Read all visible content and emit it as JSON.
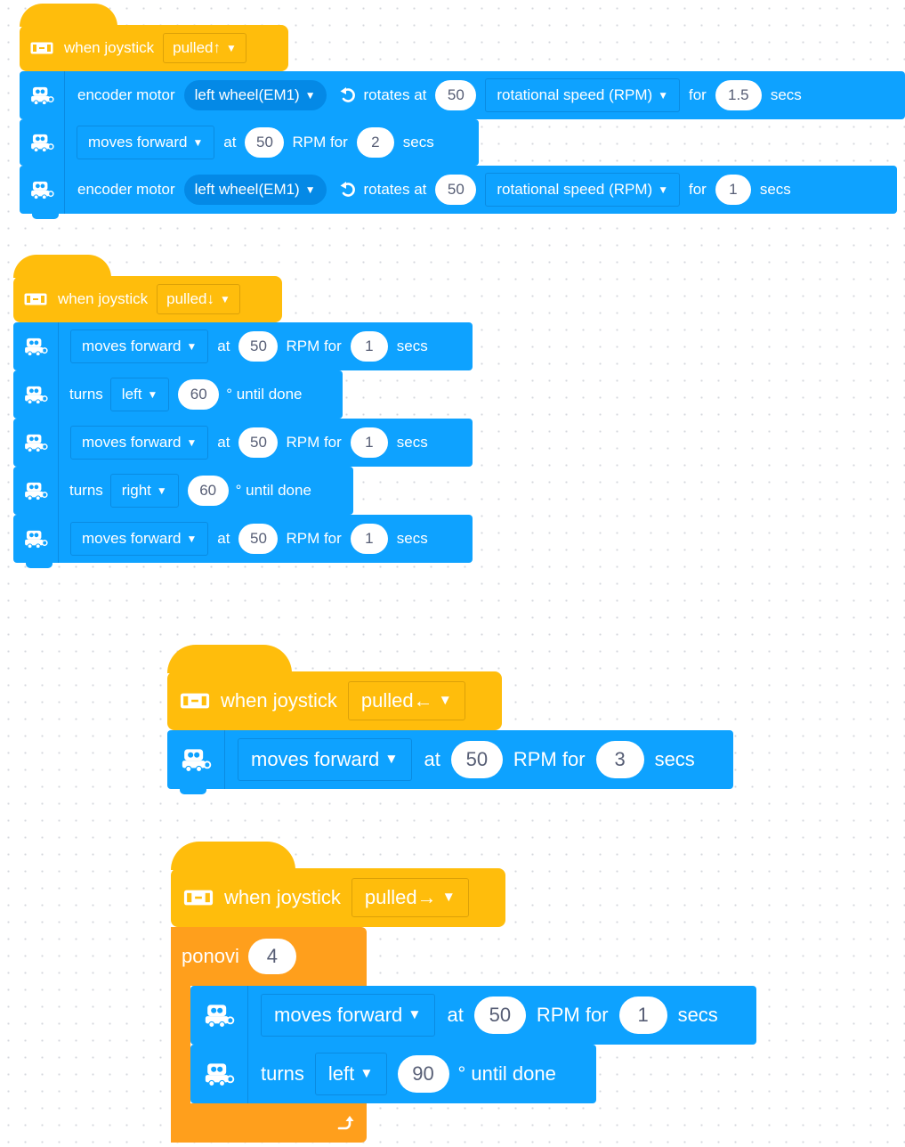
{
  "colors": {
    "event": "#ffbd0c",
    "motion": "#0ea2ff",
    "control": "#ff9f1c",
    "pill_text": "#575e75"
  },
  "icons": {
    "joystick": "joystick-icon",
    "robot": "robot-icon",
    "rotate": "counterclockwise-arrow-icon",
    "loop": "loop-arrow-icon"
  },
  "script1": {
    "hat": {
      "text": "when joystick",
      "dir": "pulled↑"
    },
    "b1": {
      "label": "encoder motor",
      "motor": "left wheel(EM1)",
      "rot": "rotates at",
      "speed": "50",
      "unit": "rotational speed (RPM)",
      "for": "for",
      "dur": "1.5",
      "secs": "secs"
    },
    "b2": {
      "dir": "moves forward",
      "at": "at",
      "speed": "50",
      "rpm": "RPM for",
      "dur": "2",
      "secs": "secs"
    },
    "b3": {
      "label": "encoder motor",
      "motor": "left wheel(EM1)",
      "rot": "rotates at",
      "speed": "50",
      "unit": "rotational speed (RPM)",
      "for": "for",
      "dur": "1",
      "secs": "secs"
    }
  },
  "script2": {
    "hat": {
      "text": "when joystick",
      "dir": "pulled↓"
    },
    "b1": {
      "dir": "moves forward",
      "at": "at",
      "speed": "50",
      "rpm": "RPM for",
      "dur": "1",
      "secs": "secs"
    },
    "b2": {
      "turns": "turns",
      "side": "left",
      "angle": "60",
      "until": "° until done"
    },
    "b3": {
      "dir": "moves forward",
      "at": "at",
      "speed": "50",
      "rpm": "RPM for",
      "dur": "1",
      "secs": "secs"
    },
    "b4": {
      "turns": "turns",
      "side": "right",
      "angle": "60",
      "until": "° until done"
    },
    "b5": {
      "dir": "moves forward",
      "at": "at",
      "speed": "50",
      "rpm": "RPM for",
      "dur": "1",
      "secs": "secs"
    }
  },
  "script3": {
    "hat": {
      "text": "when joystick",
      "dir": "pulled←"
    },
    "b1": {
      "dir": "moves forward",
      "at": "at",
      "speed": "50",
      "rpm": "RPM for",
      "dur": "3",
      "secs": "secs"
    }
  },
  "script4": {
    "hat": {
      "text": "when joystick",
      "dir": "pulled→"
    },
    "repeat": {
      "label": "ponovi",
      "count": "4"
    },
    "b1": {
      "dir": "moves forward",
      "at": "at",
      "speed": "50",
      "rpm": "RPM for",
      "dur": "1",
      "secs": "secs"
    },
    "b2": {
      "turns": "turns",
      "side": "left",
      "angle": "90",
      "until": "° until done"
    }
  }
}
